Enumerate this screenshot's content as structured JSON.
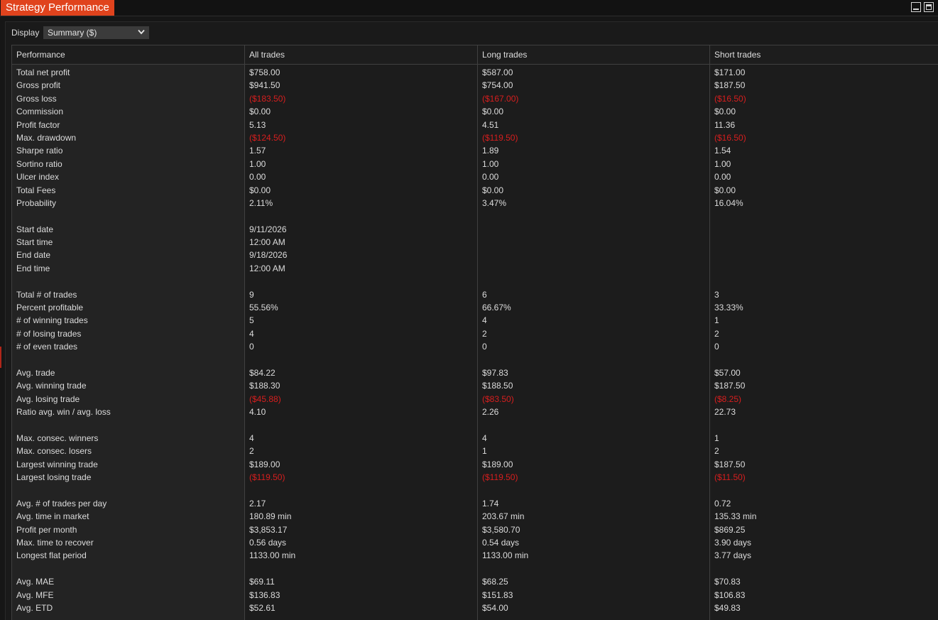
{
  "window": {
    "title": "Strategy Performance"
  },
  "display": {
    "label": "Display",
    "selected": "Summary ($)"
  },
  "colors": {
    "accent": "#e0431d",
    "negative": "#d81e1e",
    "text": "#dcdcdc",
    "background": "#1c1c1c"
  },
  "table": {
    "headers": [
      "Performance",
      "All trades",
      "Long trades",
      "Short trades"
    ],
    "rows": [
      [
        "Total net profit",
        "$758.00",
        "$587.00",
        "$171.00"
      ],
      [
        "Gross profit",
        "$941.50",
        "$754.00",
        "$187.50"
      ],
      [
        "Gross loss",
        "($183.50)",
        "($167.00)",
        "($16.50)"
      ],
      [
        "Commission",
        "$0.00",
        "$0.00",
        "$0.00"
      ],
      [
        "Profit factor",
        "5.13",
        "4.51",
        "11.36"
      ],
      [
        "Max. drawdown",
        "($124.50)",
        "($119.50)",
        "($16.50)"
      ],
      [
        "Sharpe ratio",
        "1.57",
        "1.89",
        "1.54"
      ],
      [
        "Sortino ratio",
        "1.00",
        "1.00",
        "1.00"
      ],
      [
        "Ulcer index",
        "0.00",
        "0.00",
        "0.00"
      ],
      [
        "Total Fees",
        "$0.00",
        "$0.00",
        "$0.00"
      ],
      [
        "Probability",
        "2.11%",
        "3.47%",
        "16.04%"
      ],
      [
        "",
        "",
        "",
        ""
      ],
      [
        "Start date",
        "9/11/2026",
        "",
        ""
      ],
      [
        "Start time",
        "12:00 AM",
        "",
        ""
      ],
      [
        "End date",
        "9/18/2026",
        "",
        ""
      ],
      [
        "End time",
        "12:00 AM",
        "",
        ""
      ],
      [
        "",
        "",
        "",
        ""
      ],
      [
        "Total # of trades",
        "9",
        "6",
        "3"
      ],
      [
        "Percent profitable",
        "55.56%",
        "66.67%",
        "33.33%"
      ],
      [
        "# of winning trades",
        "5",
        "4",
        "1"
      ],
      [
        "# of losing trades",
        "4",
        "2",
        "2"
      ],
      [
        "# of even trades",
        "0",
        "0",
        "0"
      ],
      [
        "",
        "",
        "",
        ""
      ],
      [
        "Avg. trade",
        "$84.22",
        "$97.83",
        "$57.00"
      ],
      [
        "Avg. winning trade",
        "$188.30",
        "$188.50",
        "$187.50"
      ],
      [
        "Avg. losing trade",
        "($45.88)",
        "($83.50)",
        "($8.25)"
      ],
      [
        "Ratio avg. win / avg. loss",
        "4.10",
        "2.26",
        "22.73"
      ],
      [
        "",
        "",
        "",
        ""
      ],
      [
        "Max. consec. winners",
        "4",
        "4",
        "1"
      ],
      [
        "Max. consec. losers",
        "2",
        "1",
        "2"
      ],
      [
        "Largest winning trade",
        "$189.00",
        "$189.00",
        "$187.50"
      ],
      [
        "Largest losing trade",
        "($119.50)",
        "($119.50)",
        "($11.50)"
      ],
      [
        "",
        "",
        "",
        ""
      ],
      [
        "Avg. # of trades per day",
        "2.17",
        "1.74",
        "0.72"
      ],
      [
        "Avg. time in market",
        "180.89 min",
        "203.67 min",
        "135.33 min"
      ],
      [
        "Profit per month",
        "$3,853.17",
        "$3,580.70",
        "$869.25"
      ],
      [
        "Max. time to recover",
        "0.56 days",
        "0.54 days",
        "3.90 days"
      ],
      [
        "Longest flat period",
        "1133.00 min",
        "1133.00 min",
        "3.77 days"
      ],
      [
        "",
        "",
        "",
        ""
      ],
      [
        "Avg. MAE",
        "$69.11",
        "$68.25",
        "$70.83"
      ],
      [
        "Avg. MFE",
        "$136.83",
        "$151.83",
        "$106.83"
      ],
      [
        "Avg. ETD",
        "$52.61",
        "$54.00",
        "$49.83"
      ]
    ]
  }
}
